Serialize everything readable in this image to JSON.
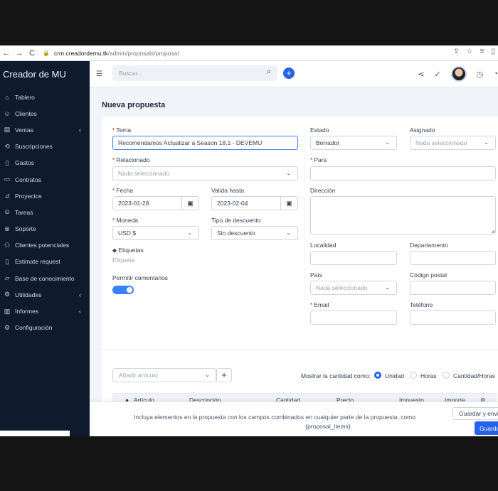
{
  "browser": {
    "url_host": "crm.creadordemu.tk",
    "url_path": "/admin/proposals/proposal"
  },
  "sidebar": {
    "brand": "Creador de MU",
    "items": [
      {
        "label": "Tablero",
        "icon": "home-icon"
      },
      {
        "label": "Clientes",
        "icon": "user-icon"
      },
      {
        "label": "Ventas",
        "icon": "document-icon",
        "has_submenu": true
      },
      {
        "label": "Suscripciones",
        "icon": "refresh-icon"
      },
      {
        "label": "Gastos",
        "icon": "file-icon"
      },
      {
        "label": "Contratos",
        "icon": "contract-icon"
      },
      {
        "label": "Proyectos",
        "icon": "chart-icon"
      },
      {
        "label": "Tareas",
        "icon": "check-circle-icon"
      },
      {
        "label": "Soporte",
        "icon": "lifebuoy-icon"
      },
      {
        "label": "Clientes potenciales",
        "icon": "users-icon"
      },
      {
        "label": "Estimate request",
        "icon": "file-icon"
      },
      {
        "label": "Base de conocimiento",
        "icon": "folder-icon"
      },
      {
        "label": "Utilidades",
        "icon": "gears-icon",
        "has_submenu": true
      },
      {
        "label": "Informes",
        "icon": "bar-chart-icon",
        "has_submenu": true
      },
      {
        "label": "Configuración",
        "icon": "gear-icon"
      }
    ]
  },
  "header": {
    "search_placeholder": "Buscar..."
  },
  "page": {
    "title": "Nueva propuesta"
  },
  "form": {
    "tema_label": "Tema",
    "tema_value": "Recomendamos Actualizar a Season 18.1 - DEVEMU",
    "relacionado_label": "Relacionado",
    "relacionado_value": "Nada seleccionado",
    "fecha_label": "Fecha",
    "fecha_value": "2023-01-28",
    "valida_label": "Valida hasta",
    "valida_value": "2023-02-04",
    "moneda_label": "Moneda",
    "moneda_value": "USD $",
    "descuento_label": "Tipo de descuento",
    "descuento_value": "Sin descuento",
    "etiquetas_label": "Etiquetas",
    "etiquetas_placeholder": "Etiqueta",
    "comentarios_label": "Permitir comentarios",
    "comentarios_enabled": true,
    "estado_label": "Estado",
    "estado_value": "Borrador",
    "asignado_label": "Asignado",
    "asignado_value": "Nada seleccionado",
    "para_label": "Para",
    "direccion_label": "Dirección",
    "localidad_label": "Localidad",
    "departamento_label": "Departamento",
    "pais_label": "País",
    "pais_value": "Nada seleccionado",
    "postal_label": "Código postal",
    "email_label": "Email",
    "telefono_label": "Teléfono"
  },
  "items": {
    "add_placeholder": "Añadir artículo",
    "qty_label": "Mostrar la cantidad como:",
    "options": [
      "Unidad",
      "Horas",
      "Cantidad/Horas"
    ],
    "selected": "Unidad",
    "columns": [
      "Artículo",
      "Descripción",
      "Cantidad",
      "Precio",
      "Impuesto",
      "Importe"
    ]
  },
  "footer": {
    "line1": "Incluya elementos en la propuesta con los campos combinados en cualquier parte de la propuesta, como",
    "line2": "{proposal_items}",
    "save_send": "Guardar y enviar",
    "save": "Guardar"
  },
  "colors": {
    "sidebar_bg": "#0f1b2d",
    "accent": "#2563eb",
    "required": "#dc2626"
  }
}
